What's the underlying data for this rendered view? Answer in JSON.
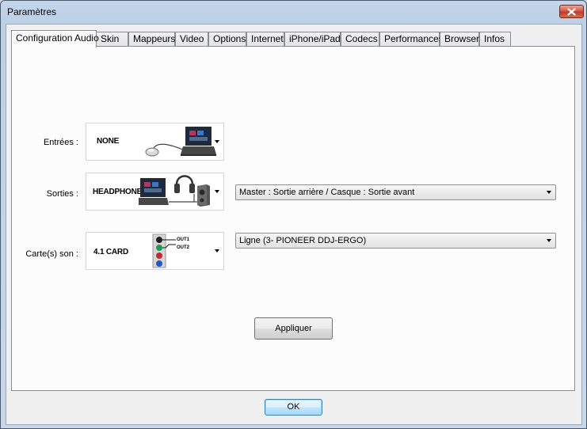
{
  "window": {
    "title": "Paramètres"
  },
  "tabs": [
    {
      "label": "Configuration Audio",
      "active": true
    },
    {
      "label": "Skin",
      "active": false
    },
    {
      "label": "Mappeurs",
      "active": false
    },
    {
      "label": "Video",
      "active": false
    },
    {
      "label": "Options",
      "active": false
    },
    {
      "label": "Internet",
      "active": false
    },
    {
      "label": "iPhone/iPad",
      "active": false
    },
    {
      "label": "Codecs",
      "active": false
    },
    {
      "label": "Performances",
      "active": false
    },
    {
      "label": "Browser",
      "active": false
    },
    {
      "label": "Infos",
      "active": false
    }
  ],
  "audio": {
    "inputs": {
      "label": "Entrées :",
      "device": "NONE",
      "icon": "laptop-with-mouse-icon"
    },
    "outputs": {
      "label": "Sorties :",
      "device": "HEADPHONES",
      "icon": "laptop-with-headphones-icon",
      "routing_value": "Master : Sortie arrière / Casque : Sortie avant"
    },
    "soundcard": {
      "label": "Carte(s) son :",
      "device": "4.1 CARD",
      "icon": "soundcard-jacks-icon",
      "out1_label": "OUT1",
      "out2_label": "OUT2",
      "line_value": "Ligne (3- PIONEER DDJ-ERGO)"
    }
  },
  "buttons": {
    "apply": "Appliquer",
    "ok": "OK"
  }
}
